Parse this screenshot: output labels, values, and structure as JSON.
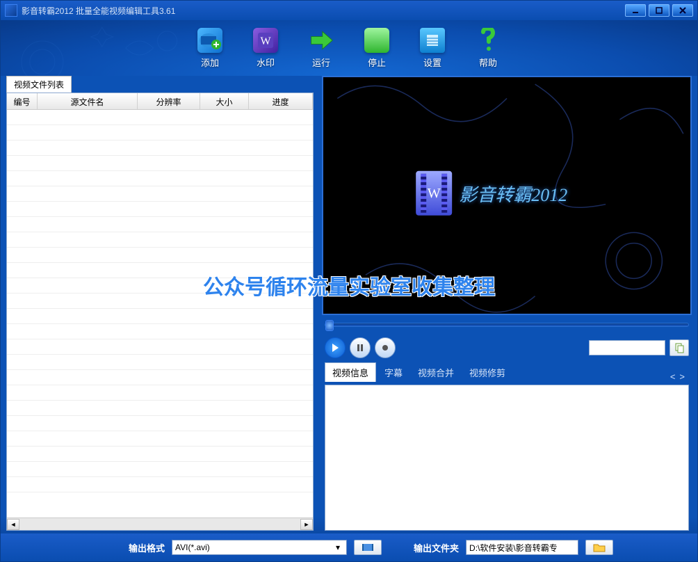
{
  "window": {
    "title": "影音转霸2012 批量全能视频编辑工具3.61"
  },
  "toolbar": {
    "items": [
      {
        "label": "添加",
        "icon": "add-icon"
      },
      {
        "label": "水印",
        "icon": "watermark-icon"
      },
      {
        "label": "运行",
        "icon": "run-icon"
      },
      {
        "label": "停止",
        "icon": "stop-icon"
      },
      {
        "label": "设置",
        "icon": "settings-icon"
      },
      {
        "label": "帮助",
        "icon": "help-icon"
      }
    ]
  },
  "filelist": {
    "tab": "视频文件列表",
    "columns": [
      "编号",
      "源文件名",
      "分辨率",
      "大小",
      "进度"
    ]
  },
  "preview": {
    "brand": "影音转霸2012"
  },
  "info_tabs": {
    "items": [
      "视频信息",
      "字幕",
      "视频合并",
      "视频修剪"
    ],
    "active": 0
  },
  "bottombar": {
    "format_label": "输出格式",
    "format_value": "AVI(*.avi)",
    "outdir_label": "输出文件夹",
    "outdir_value": "D:\\软件安装\\影音转霸专"
  },
  "overlay_watermark": "公众号循环流量实验室收集整理"
}
